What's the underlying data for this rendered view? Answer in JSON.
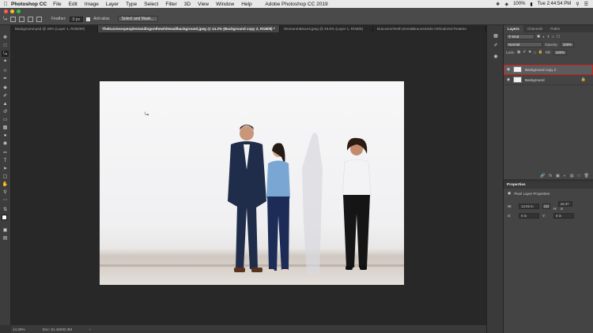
{
  "menubar": {
    "app_name": "Photoshop CC",
    "items": [
      "File",
      "Edit",
      "Image",
      "Layer",
      "Type",
      "Select",
      "Filter",
      "3D",
      "View",
      "Window",
      "Help"
    ],
    "window_title": "Adobe Photoshop CC 2019",
    "battery": "100%",
    "clock": "Tue 2:44:54 PM"
  },
  "options": {
    "feather_label": "Feather:",
    "feather_value": "0 px",
    "antialias_label": "Anti-alias",
    "select_mask_label": "Select and Mask..."
  },
  "tabs": [
    "Background.psd @ 25% (Layer 1, RGB/8#)",
    "Thebusinesspeoplestandingonthewhitewallbackground.jpeg @ 14.2% (Background copy 2, RGB/8) *",
    "WomanInBraces.jpeg @ 46.8% (Layer 1, RGB/8)",
    "BracesonTeeth.DentalBracesSmile.OrthodonticTreatme"
  ],
  "status": {
    "zoom": "14.29%",
    "doc": "Doc: 81.1M/82.3M"
  },
  "layers_panel": {
    "tabs": [
      "Layers",
      "Channels",
      "Paths"
    ],
    "kind_label": "Kind",
    "blend_mode": "Normal",
    "opacity_label": "Opacity:",
    "opacity_value": "100%",
    "lock_label": "Lock:",
    "fill_label": "Fill:",
    "fill_value": "100%",
    "layers": [
      {
        "name": "Background copy 2",
        "selected": true
      },
      {
        "name": "Background",
        "selected": false
      }
    ]
  },
  "properties_panel": {
    "title": "Properties",
    "subtitle": "Pixel Layer Properties",
    "w_label": "W:",
    "w_value": "13.02 in",
    "go_label": "GO",
    "h_label": "H:",
    "h_value": "15.37 in",
    "x_label": "X:",
    "x_value": "0 in",
    "y_label": "Y:",
    "y_value": "0 in"
  },
  "colors": {
    "selection_outline": "#d21d1d",
    "panel_bg": "#444444",
    "workspace_bg": "#282828"
  }
}
